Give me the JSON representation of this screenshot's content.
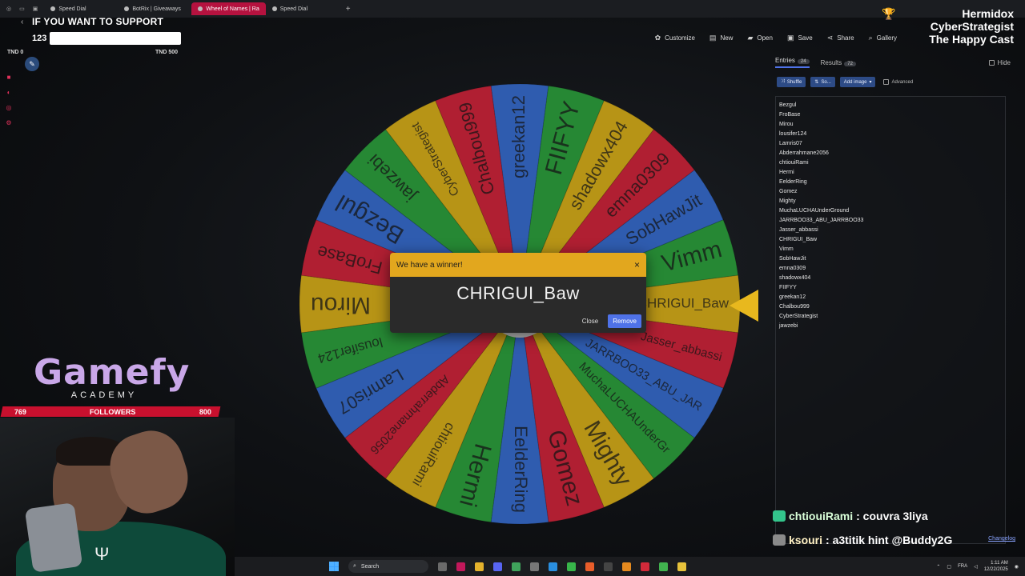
{
  "browser": {
    "tabs": [
      {
        "label": "Speed Dial",
        "active": false
      },
      {
        "label": "BotRix | Giveaways",
        "active": false
      },
      {
        "label": "Wheel of Names | Ra",
        "active": true
      },
      {
        "label": "Speed Dial",
        "active": false
      }
    ],
    "new_tab": "+"
  },
  "overlay_top": {
    "support_text": "IF YOU WANT TO SUPPORT",
    "support_count": "123",
    "tnd_left": "TND 0",
    "tnd_right": "TND 500"
  },
  "toolbar": {
    "items": [
      {
        "label": "Customize",
        "icon": "palette-icon"
      },
      {
        "label": "New",
        "icon": "file-icon"
      },
      {
        "label": "Open",
        "icon": "folder-icon"
      },
      {
        "label": "Save",
        "icon": "save-icon"
      },
      {
        "label": "Share",
        "icon": "share-icon"
      },
      {
        "label": "Gallery",
        "icon": "search-icon"
      }
    ]
  },
  "streamer": {
    "name": "Hermidox",
    "line2": "CyberStrategist",
    "line3": "The Happy Cast"
  },
  "logo": {
    "name": "Gamefy",
    "subtitle": "ACADEMY"
  },
  "followers": {
    "current": "769",
    "label": "FOLLOWERS",
    "goal": "800",
    "progress": 0.96
  },
  "wheel": {
    "segments": [
      {
        "name": "greekan12",
        "color": "#3a71d6"
      },
      {
        "name": "FIIFYY",
        "color": "#2fa640"
      },
      {
        "name": "shadowx404",
        "color": "#e0b51c"
      },
      {
        "name": "emna0309",
        "color": "#d7263d"
      },
      {
        "name": "SobHawJit",
        "color": "#3a71d6"
      },
      {
        "name": "Vimm",
        "color": "#2fa640"
      },
      {
        "name": "CHRIGUI_Baw",
        "color": "#e0b51c"
      },
      {
        "name": "Jasser_abbassi",
        "color": "#d7263d"
      },
      {
        "name": "JARRBOO33_ABU_JAR",
        "color": "#3a71d6"
      },
      {
        "name": "MuchaLUCHAUnderGr",
        "color": "#2fa640"
      },
      {
        "name": "Mighty",
        "color": "#e0b51c"
      },
      {
        "name": "Gomez",
        "color": "#d7263d"
      },
      {
        "name": "EelderRing",
        "color": "#3a71d6"
      },
      {
        "name": "Hermi",
        "color": "#2fa640"
      },
      {
        "name": "chtiouiRami",
        "color": "#e0b51c"
      },
      {
        "name": "Abderrahmane2056",
        "color": "#d7263d"
      },
      {
        "name": "Lamris07",
        "color": "#3a71d6"
      },
      {
        "name": "lousifer124",
        "color": "#2fa640"
      },
      {
        "name": "Mirou",
        "color": "#e0b51c"
      },
      {
        "name": "FroBase",
        "color": "#d7263d"
      },
      {
        "name": "Bezgul",
        "color": "#3a71d6"
      },
      {
        "name": "jawzebi",
        "color": "#2fa640"
      },
      {
        "name": "CyberStrategist",
        "color": "#e0b51c"
      },
      {
        "name": "Chalbou999",
        "color": "#d7263d"
      }
    ]
  },
  "modal": {
    "title": "We have a winner!",
    "winner": "CHRIGUI_Baw",
    "close_label": "Close",
    "remove_label": "Remove",
    "x": "×"
  },
  "panel": {
    "tab_entries": "Entries",
    "entries_count": "24",
    "tab_results": "Results",
    "results_count": "72",
    "hide_label": "Hide",
    "shuffle_label": "Shuffle",
    "sort_label": "So...",
    "add_image_label": "Add image",
    "advanced_label": "Advanced",
    "entries": [
      "Bezgul",
      "FroBase",
      "Mirou",
      "lousifer124",
      "Lamris07",
      "Abderrahmane2056",
      "chtiouiRami",
      "Hermi",
      "EelderRing",
      "Gomez",
      "Mighty",
      "MuchaLUCHAUnderGround",
      "JARRBOO33_ABU_JARRBOO33",
      "Jasser_abbassi",
      "CHRIGUI_Baw",
      "Vimm",
      "SobHawJit",
      "emna0309",
      "shadowx404",
      "FIIFYY",
      "greekan12",
      "Chalbou999",
      "CyberStrategist",
      "jawzebi"
    ]
  },
  "chat": [
    {
      "user": "chtiouiRami",
      "message": ": couvra 3liya"
    },
    {
      "user": "ksouri",
      "message": ": a3titik hint @Buddy2G"
    }
  ],
  "changelog_label": "Changelog",
  "taskbar": {
    "search_label": "Search",
    "lang": "FRA",
    "time": "1:11 AM",
    "date": "12/22/2025"
  }
}
